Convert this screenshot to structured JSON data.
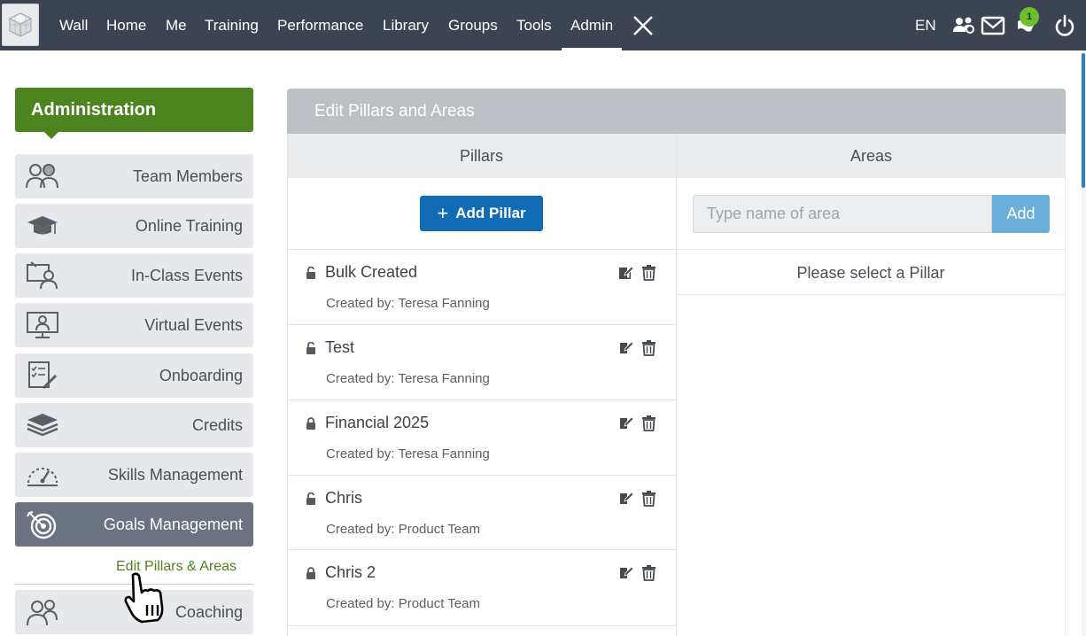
{
  "nav": {
    "items": [
      "Wall",
      "Home",
      "Me",
      "Training",
      "Performance",
      "Library",
      "Groups",
      "Tools",
      "Admin"
    ],
    "active": "Admin",
    "language": "EN",
    "notification_count": "1"
  },
  "sidebar": {
    "header": "Administration",
    "items": [
      {
        "label": "Team Members",
        "icon": "team-members-icon"
      },
      {
        "label": "Online Training",
        "icon": "graduation-cap-icon"
      },
      {
        "label": "In-Class Events",
        "icon": "classroom-icon"
      },
      {
        "label": "Virtual Events",
        "icon": "monitor-person-icon"
      },
      {
        "label": "Onboarding",
        "icon": "checklist-icon"
      },
      {
        "label": "Credits",
        "icon": "layers-icon"
      },
      {
        "label": "Skills Management",
        "icon": "gauge-icon"
      },
      {
        "label": "Goals Management",
        "icon": "target-icon"
      },
      {
        "label": "Coaching",
        "icon": "coaching-icon"
      }
    ],
    "active_item": "Goals Management",
    "sub_link": "Edit Pillars & Areas"
  },
  "panel": {
    "title": "Edit Pillars and Areas",
    "pillars_header": "Pillars",
    "areas_header": "Areas",
    "add_pillar_label": "Add Pillar",
    "area_placeholder": "Type name of area",
    "area_add_label": "Add",
    "areas_message": "Please select a Pillar",
    "pillars": [
      {
        "name": "Bulk Created",
        "created_by": "Created by: Teresa Fanning",
        "locked": false
      },
      {
        "name": "Test",
        "created_by": "Created by: Teresa Fanning",
        "locked": false
      },
      {
        "name": "Financial 2025",
        "created_by": "Created by: Teresa Fanning",
        "locked": true
      },
      {
        "name": "Chris",
        "created_by": "Created by: Product Team",
        "locked": false
      },
      {
        "name": "Chris 2",
        "created_by": "Created by: Product Team",
        "locked": true
      }
    ]
  },
  "colors": {
    "topbar": "#3b4450",
    "admin_green": "#4d8420",
    "primary_blue": "#116bb5",
    "light_blue": "#6aaed9",
    "active_gray": "#6b7380"
  }
}
